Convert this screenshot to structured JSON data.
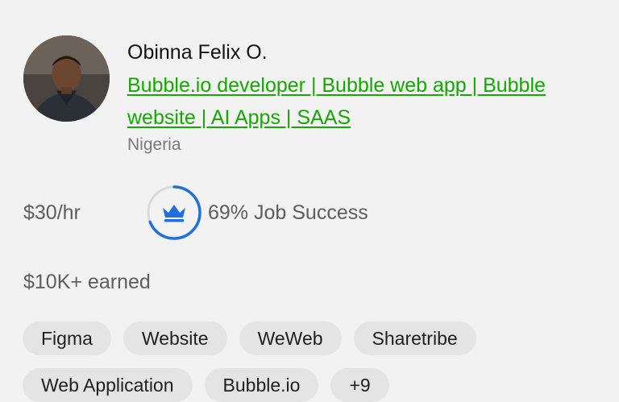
{
  "freelancer": {
    "name": "Obinna Felix O.",
    "title": "Bubble.io developer | Bubble web app | Bubble website | AI Apps | SAAS",
    "location": "Nigeria",
    "rate": "$30/hr",
    "job_success": "69% Job Success",
    "job_success_fraction": 0.69,
    "earned": "$10K+ earned"
  },
  "skills": [
    "Figma",
    "Website",
    "WeWeb",
    "Sharetribe",
    "Web Application",
    "Bubble.io",
    "+9"
  ],
  "colors": {
    "link": "#14a800",
    "ring": "#1f6fde",
    "ring_track": "#d9d9d9",
    "badge_bg": "#e4e4e4",
    "background": "#f2f2f2"
  },
  "icons": {
    "jss_badge": "crown-icon"
  }
}
